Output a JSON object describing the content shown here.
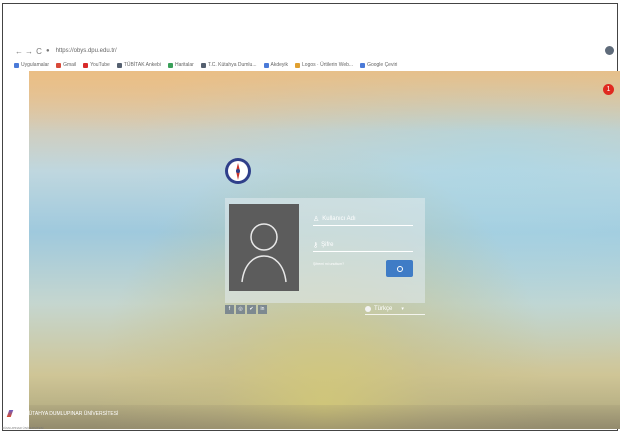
{
  "browser": {
    "url": "https://obys.dpu.edu.tr/",
    "nav": {
      "back": "←",
      "forward": "→",
      "reload": "C"
    },
    "bookmarks": [
      {
        "label": "Uygulamalar",
        "color": "#4a7ad8"
      },
      {
        "label": "Gmail",
        "color": "#d84a3a"
      },
      {
        "label": "YouTube",
        "color": "#d82a2a"
      },
      {
        "label": "TÜBİTAK Ankebi",
        "color": "#556070"
      },
      {
        "label": "Haritalar",
        "color": "#3aa05a"
      },
      {
        "label": "T.C. Kütahya Dumlu...",
        "color": "#556070"
      },
      {
        "label": "Akdeyik",
        "color": "#4a7ad8"
      },
      {
        "label": "Logos · Ürtilerin Web...",
        "color": "#e0a030"
      },
      {
        "label": "Google Çeviri",
        "color": "#4a7ad8"
      }
    ]
  },
  "page": {
    "notification_count": "1",
    "login": {
      "username_placeholder": "Kullanıcı Adı",
      "password_placeholder": "Şifre",
      "forgot_link": "Şifremi mi unuttum?"
    },
    "socials": [
      "f",
      "◎",
      "✔",
      "in"
    ],
    "language": "Türkçe",
    "footer": "T.C. KÜTAHYA DUMLUPINAR ÜNİVERSİTESİ",
    "tiny": "DÜMLUPINAR ÜNİVERSİTESİ"
  },
  "colors": {
    "accent": "#3f7cc6",
    "notification": "#e0291f",
    "avatar_bg": "#5c5c5c"
  }
}
